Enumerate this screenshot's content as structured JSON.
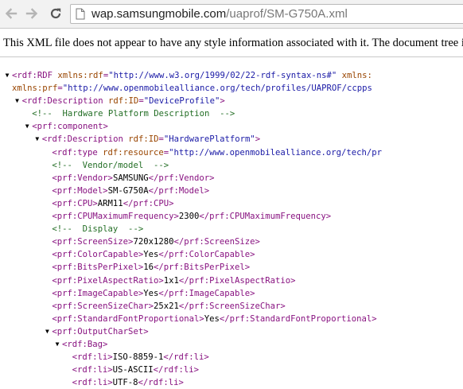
{
  "browser": {
    "url_host": "wap.samsungmobile.com",
    "url_path": "/uaprof/SM-G750A.xml"
  },
  "info_message": "This XML file does not appear to have any style information associated with it. The document tree is shown below.",
  "xml_lines": [
    {
      "indent": 0,
      "toggle": "expanded",
      "parts": [
        {
          "t": "tag",
          "v": "<rdf:RDF "
        },
        {
          "t": "an",
          "v": "xmlns:rdf"
        },
        {
          "t": "tag",
          "v": "="
        },
        {
          "t": "av",
          "v": "\"http://www.w3.org/1999/02/22-rdf-syntax-ns#\""
        },
        {
          "t": "tag",
          "v": " "
        },
        {
          "t": "an",
          "v": "xmlns:"
        }
      ]
    },
    {
      "indent": 0,
      "toggle": "",
      "parts": [
        {
          "t": "an",
          "v": "xmlns:prf"
        },
        {
          "t": "tag",
          "v": "="
        },
        {
          "t": "av",
          "v": "\"http://www.openmobilealliance.org/tech/profiles/UAPROF/ccpps"
        }
      ]
    },
    {
      "indent": 1,
      "toggle": "expanded",
      "parts": [
        {
          "t": "tag",
          "v": "<rdf:Description "
        },
        {
          "t": "an",
          "v": "rdf:ID"
        },
        {
          "t": "tag",
          "v": "="
        },
        {
          "t": "av",
          "v": "\"DeviceProfile\""
        },
        {
          "t": "tag",
          "v": ">"
        }
      ]
    },
    {
      "indent": 2,
      "toggle": "",
      "parts": [
        {
          "t": "cm",
          "v": "<!--  Hardware Platform Description  -->"
        }
      ]
    },
    {
      "indent": 2,
      "toggle": "expanded",
      "parts": [
        {
          "t": "tag",
          "v": "<prf:component>"
        }
      ]
    },
    {
      "indent": 3,
      "toggle": "expanded",
      "parts": [
        {
          "t": "tag",
          "v": "<rdf:Description "
        },
        {
          "t": "an",
          "v": "rdf:ID"
        },
        {
          "t": "tag",
          "v": "="
        },
        {
          "t": "av",
          "v": "\"HardwarePlatform\""
        },
        {
          "t": "tag",
          "v": ">"
        }
      ]
    },
    {
      "indent": 4,
      "toggle": "",
      "parts": [
        {
          "t": "tag",
          "v": "<rdf:type "
        },
        {
          "t": "an",
          "v": "rdf:resource"
        },
        {
          "t": "tag",
          "v": "="
        },
        {
          "t": "av",
          "v": "\"http://www.openmobilealliance.org/tech/pr"
        }
      ]
    },
    {
      "indent": 4,
      "toggle": "",
      "parts": [
        {
          "t": "cm",
          "v": "<!--  Vendor/model  -->"
        }
      ]
    },
    {
      "indent": 4,
      "toggle": "",
      "parts": [
        {
          "t": "tag",
          "v": "<prf:Vendor>"
        },
        {
          "t": "tx",
          "v": "SAMSUNG"
        },
        {
          "t": "tag",
          "v": "</prf:Vendor>"
        }
      ]
    },
    {
      "indent": 4,
      "toggle": "",
      "parts": [
        {
          "t": "tag",
          "v": "<prf:Model>"
        },
        {
          "t": "tx",
          "v": "SM-G750A"
        },
        {
          "t": "tag",
          "v": "</prf:Model>"
        }
      ]
    },
    {
      "indent": 4,
      "toggle": "",
      "parts": [
        {
          "t": "tag",
          "v": "<prf:CPU>"
        },
        {
          "t": "tx",
          "v": "ARM11"
        },
        {
          "t": "tag",
          "v": "</prf:CPU>"
        }
      ]
    },
    {
      "indent": 4,
      "toggle": "",
      "parts": [
        {
          "t": "tag",
          "v": "<prf:CPUMaximumFrequency>"
        },
        {
          "t": "tx",
          "v": "2300"
        },
        {
          "t": "tag",
          "v": "</prf:CPUMaximumFrequency>"
        }
      ]
    },
    {
      "indent": 4,
      "toggle": "",
      "parts": [
        {
          "t": "cm",
          "v": "<!--  Display  -->"
        }
      ]
    },
    {
      "indent": 4,
      "toggle": "",
      "parts": [
        {
          "t": "tag",
          "v": "<prf:ScreenSize>"
        },
        {
          "t": "tx",
          "v": "720x1280"
        },
        {
          "t": "tag",
          "v": "</prf:ScreenSize>"
        }
      ]
    },
    {
      "indent": 4,
      "toggle": "",
      "parts": [
        {
          "t": "tag",
          "v": "<prf:ColorCapable>"
        },
        {
          "t": "tx",
          "v": "Yes"
        },
        {
          "t": "tag",
          "v": "</prf:ColorCapable>"
        }
      ]
    },
    {
      "indent": 4,
      "toggle": "",
      "parts": [
        {
          "t": "tag",
          "v": "<prf:BitsPerPixel>"
        },
        {
          "t": "tx",
          "v": "16"
        },
        {
          "t": "tag",
          "v": "</prf:BitsPerPixel>"
        }
      ]
    },
    {
      "indent": 4,
      "toggle": "",
      "parts": [
        {
          "t": "tag",
          "v": "<prf:PixelAspectRatio>"
        },
        {
          "t": "tx",
          "v": "1x1"
        },
        {
          "t": "tag",
          "v": "</prf:PixelAspectRatio>"
        }
      ]
    },
    {
      "indent": 4,
      "toggle": "",
      "parts": [
        {
          "t": "tag",
          "v": "<prf:ImageCapable>"
        },
        {
          "t": "tx",
          "v": "Yes"
        },
        {
          "t": "tag",
          "v": "</prf:ImageCapable>"
        }
      ]
    },
    {
      "indent": 4,
      "toggle": "",
      "parts": [
        {
          "t": "tag",
          "v": "<prf:ScreenSizeChar>"
        },
        {
          "t": "tx",
          "v": "25x21"
        },
        {
          "t": "tag",
          "v": "</prf:ScreenSizeChar>"
        }
      ]
    },
    {
      "indent": 4,
      "toggle": "",
      "parts": [
        {
          "t": "tag",
          "v": "<prf:StandardFontProportional>"
        },
        {
          "t": "tx",
          "v": "Yes"
        },
        {
          "t": "tag",
          "v": "</prf:StandardFontProportional>"
        }
      ]
    },
    {
      "indent": 4,
      "toggle": "expanded",
      "parts": [
        {
          "t": "tag",
          "v": "<prf:OutputCharSet>"
        }
      ]
    },
    {
      "indent": 5,
      "toggle": "expanded",
      "parts": [
        {
          "t": "tag",
          "v": "<rdf:Bag>"
        }
      ]
    },
    {
      "indent": 6,
      "toggle": "",
      "parts": [
        {
          "t": "tag",
          "v": "<rdf:li>"
        },
        {
          "t": "tx",
          "v": "ISO-8859-1"
        },
        {
          "t": "tag",
          "v": "</rdf:li>"
        }
      ]
    },
    {
      "indent": 6,
      "toggle": "",
      "parts": [
        {
          "t": "tag",
          "v": "<rdf:li>"
        },
        {
          "t": "tx",
          "v": "US-ASCII"
        },
        {
          "t": "tag",
          "v": "</rdf:li>"
        }
      ]
    },
    {
      "indent": 6,
      "toggle": "",
      "parts": [
        {
          "t": "tag",
          "v": "<rdf:li>"
        },
        {
          "t": "tx",
          "v": "UTF-8"
        },
        {
          "t": "tag",
          "v": "</rdf:li>"
        }
      ]
    }
  ],
  "icons": {
    "back": "arrow-left-icon",
    "forward": "arrow-right-icon",
    "reload": "reload-icon",
    "page": "page-icon",
    "expanded_toggle": "triangle-down-icon"
  },
  "colors": {
    "tag": "#881280",
    "attribute_name": "#994500",
    "attribute_value": "#1a1aa6",
    "comment": "#236e25"
  }
}
